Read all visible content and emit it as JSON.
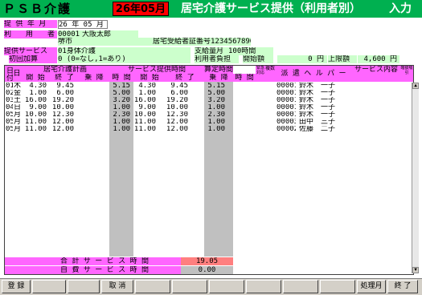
{
  "header": {
    "app_name": "ＰＳＢ介護",
    "month": "26年05月",
    "title": "居宅介護サービス提供（利用者別）",
    "mode": "入力"
  },
  "info": {
    "provide_ym_label": "提 供 年 月",
    "provide_ym_value": "26 年 05 月",
    "user_label": "利　　用　　者",
    "user_code": "00001",
    "user_name": "大阪太郎",
    "city": "堺市",
    "cert_label": "居宅受給者証番号",
    "cert_no": "1234567890",
    "service_label": "提供サービス",
    "service_value": "01身体介護",
    "payment_label": "支給量月",
    "payment_value": "100時間",
    "initial_label": "初回加算",
    "initial_value": "0 (0=なし,1=あり)",
    "burden_label": "利用者負担",
    "start_label": "開始額",
    "start_value": "0 円",
    "limit_label": "上限額",
    "limit_value": "4,600 円"
  },
  "grid": {
    "h_day": "日付",
    "h_dow": "日",
    "h_plan": "居宅介護計画",
    "h_service": "サービス提供時間",
    "h_calc": "算定時間",
    "h_start": "開 始",
    "h_end": "終 了",
    "h_ride": "乗 降",
    "h_time": "時 間",
    "h_move": "移動",
    "h_x1": "緊急対応",
    "h_x2": "複数",
    "h_helper": "派 遣 ヘ ル パ ー",
    "h_content": "サービス内容",
    "h_extra": "喀痰吸引",
    "rows": [
      {
        "day": "01",
        "dow": "木",
        "ps": "4.30",
        "pe": "9.45",
        "pt": "5.15",
        "ss": "4.30",
        "se": "9.45",
        "st": "5.15",
        "code": "00001",
        "name": "鈴木　一子"
      },
      {
        "day": "02",
        "dow": "金",
        "ps": "1.00",
        "pe": "6.00",
        "pt": "5.00",
        "ss": "1.00",
        "se": "6.00",
        "st": "5.00",
        "code": "00001",
        "name": "鈴木　一子"
      },
      {
        "day": "03",
        "dow": "土",
        "ps": "16.00",
        "pe": "19.20",
        "pt": "3.20",
        "ss": "16.00",
        "se": "19.20",
        "st": "3.20",
        "code": "00001",
        "name": "鈴木　一子"
      },
      {
        "day": "04",
        "dow": "日",
        "ps": "9.00",
        "pe": "10.00",
        "pt": "1.00",
        "ss": "9.00",
        "se": "10.00",
        "st": "1.00",
        "code": "00001",
        "name": "鈴木　一子"
      },
      {
        "day": "05",
        "dow": "月",
        "ps": "10.00",
        "pe": "12.30",
        "pt": "2.30",
        "ss": "10.00",
        "se": "12.30",
        "st": "2.30",
        "code": "00001",
        "name": "鈴木　一子"
      },
      {
        "day": "05",
        "dow": "月",
        "ps": "11.00",
        "pe": "12.00",
        "pt": "1.00",
        "ss": "11.00",
        "se": "12.00",
        "st": "1.00",
        "code": "00003",
        "name": "田中　三子"
      },
      {
        "day": "05",
        "dow": "月",
        "ps": "11.00",
        "pe": "12.00",
        "pt": "1.00",
        "ss": "11.00",
        "se": "12.00",
        "st": "1.00",
        "code": "00002",
        "name": "佐藤　二子"
      }
    ]
  },
  "totals": {
    "total_label": "合 計 サ ー ビ ス 時 間",
    "total_value": "19.05",
    "self_label": "自 費 サ ー ビ ス 時 間",
    "self_value": "0.00"
  },
  "footer": {
    "register": "登 録",
    "cancel": "取 消",
    "process_month": "処理月",
    "exit": "終 了"
  }
}
